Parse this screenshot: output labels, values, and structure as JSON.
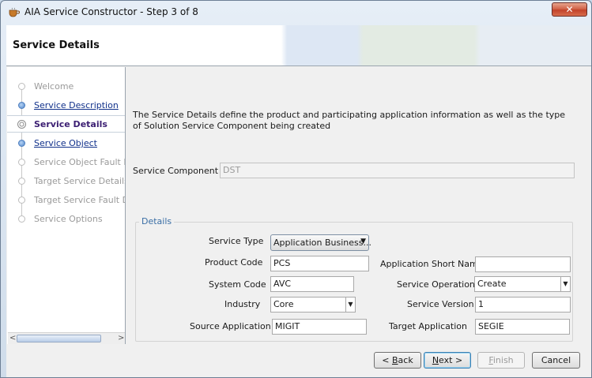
{
  "window": {
    "title": "AIA Service Constructor - Step 3 of 8",
    "close_label": "✕"
  },
  "header": {
    "title": "Service Details"
  },
  "nav": {
    "items": [
      {
        "label": "Welcome",
        "state": "disabled"
      },
      {
        "label": "Service Description",
        "state": "link"
      },
      {
        "label": "Service Details",
        "state": "current"
      },
      {
        "label": "Service Object",
        "state": "link"
      },
      {
        "label": "Service Object Fault Det",
        "state": "disabled"
      },
      {
        "label": "Target Service Details",
        "state": "disabled"
      },
      {
        "label": "Target Service Fault Det",
        "state": "disabled"
      },
      {
        "label": "Service Options",
        "state": "disabled"
      }
    ],
    "scroll_left": "<",
    "scroll_right": ">"
  },
  "main": {
    "description": "The Service Details define the product and participating application information as well as the type of Solution Service Component being created",
    "service_component_label": "Service Component",
    "service_component_value": "DST",
    "details_legend": "Details",
    "service_type_label": "Service Type",
    "service_type_value": "Application Business...",
    "product_code_label": "Product Code",
    "product_code_value": "PCS",
    "app_short_name_label": "Application Short Name",
    "app_short_name_value": "",
    "system_code_label": "System Code",
    "system_code_value": "AVC",
    "service_operation_label": "Service Operation",
    "service_operation_value": "Create",
    "industry_label": "Industry",
    "industry_value": "Core",
    "service_version_label": "Service Version",
    "service_version_value": "1",
    "source_app_label": "Source Application",
    "source_app_value": "MIGIT",
    "target_app_label": "Target Application",
    "target_app_value": "SEGIE"
  },
  "buttons": {
    "back_prefix": "< ",
    "back_mnemonic": "B",
    "back_rest": "ack",
    "next_mnemonic": "N",
    "next_rest": "ext >",
    "finish_mnemonic": "F",
    "finish_rest": "inish",
    "cancel": "Cancel"
  }
}
